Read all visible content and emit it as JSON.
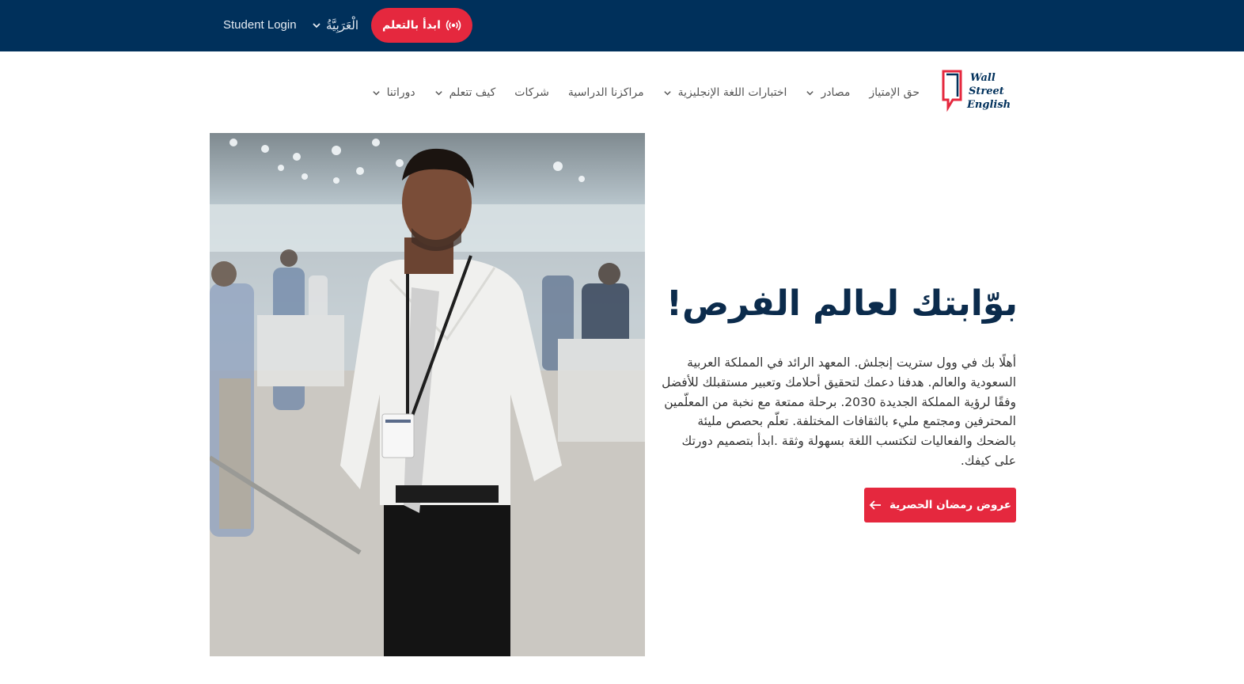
{
  "topbar": {
    "cta_label": "ابدأ بالتعلم",
    "cta_icon": "radio-wave-icon",
    "language_label": "الْعَرَبِيَّةُ",
    "student_login_label": "Student Login"
  },
  "brand": {
    "logo_lines": [
      "Wall",
      "Street",
      "English"
    ],
    "colors": {
      "navy": "#00305b",
      "red": "#e5283e"
    }
  },
  "nav": {
    "items": [
      {
        "label": "دوراتنا",
        "has_dropdown": true
      },
      {
        "label": "كيف تتعلم",
        "has_dropdown": true
      },
      {
        "label": "شركات",
        "has_dropdown": false
      },
      {
        "label": "مراكزنا الدراسية",
        "has_dropdown": false
      },
      {
        "label": "اختبارات اللغة الإنجليزية",
        "has_dropdown": true
      },
      {
        "label": "مصادر",
        "has_dropdown": true
      },
      {
        "label": "حق الإمتياز",
        "has_dropdown": false
      }
    ]
  },
  "hero": {
    "title": "بوّابتك لعالم الفرص!",
    "body": "أهلًا بك في وول ستريت إنجلش. المعهد الرائد في المملكة العربية السعودية والعالم. هدفنا دعمك لتحقيق أحلامك وتعبير مستقبلك للأفضل وفقًا لرؤية المملكة الجديدة 2030. برحلة ممتعة مع نخبة من المعلّمين المحترفين ومجتمع مليء بالثقافات المختلفة. تعلّم بحصص مليئة بالضحك والفعاليات لتكتسب اللغة بسهولة وثقة .ابدأ بتصميم دورتك على كيفك.",
    "cta_label": "عروض رمضان الحصرية",
    "cta_icon": "arrow-left-icon"
  }
}
